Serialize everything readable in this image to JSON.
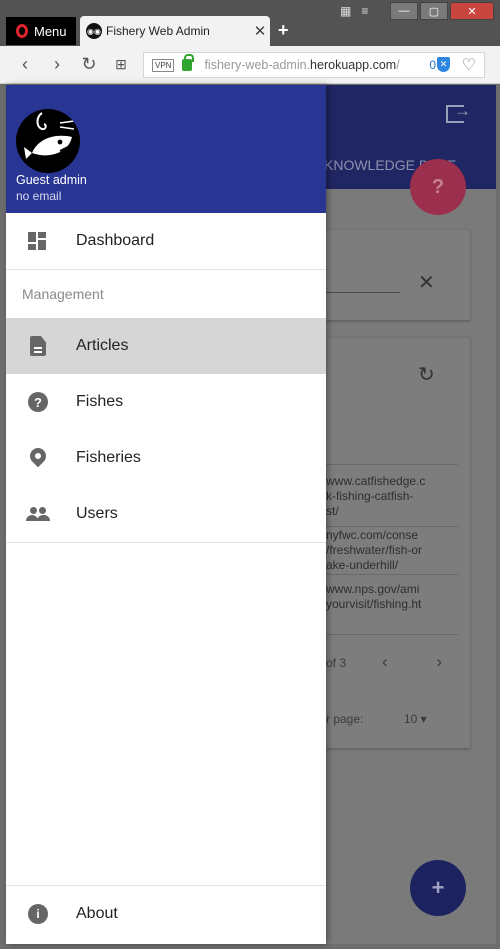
{
  "browser": {
    "menu_label": "Menu",
    "tab_title": "Fishery Web Admin",
    "url_host": "fishery-web-admin.",
    "url_domain": "herokuapp.com",
    "url_path": "/",
    "vpn_label": "VPN",
    "blocked_count": "0"
  },
  "page": {
    "tab_label": "KNOWLEDGE BASE",
    "rows": [
      "www.catfishedge.c\nk-fishing-catfish-\nst/",
      "nyfwc.com/conse\n/freshwater/fish-or\nake-underhill/",
      "www.nps.gov/ami\nyourvisit/fishing.ht"
    ],
    "pager_text": "of 3",
    "rows_per_page_label": "r page:",
    "rows_per_page_value": "10 ▾"
  },
  "drawer": {
    "user_name": "Guest admin",
    "user_email": "no email",
    "dashboard_label": "Dashboard",
    "section_label": "Management",
    "items": [
      {
        "label": "Articles",
        "icon": "article-icon"
      },
      {
        "label": "Fishes",
        "icon": "help-icon"
      },
      {
        "label": "Fisheries",
        "icon": "location-pin-icon"
      },
      {
        "label": "Users",
        "icon": "users-icon"
      }
    ],
    "about_label": "About"
  },
  "colors": {
    "drawer_header": "#283593",
    "active_item": "#d6d6d6",
    "help_fab": "#e91e63",
    "add_fab": "#3f51b5"
  }
}
